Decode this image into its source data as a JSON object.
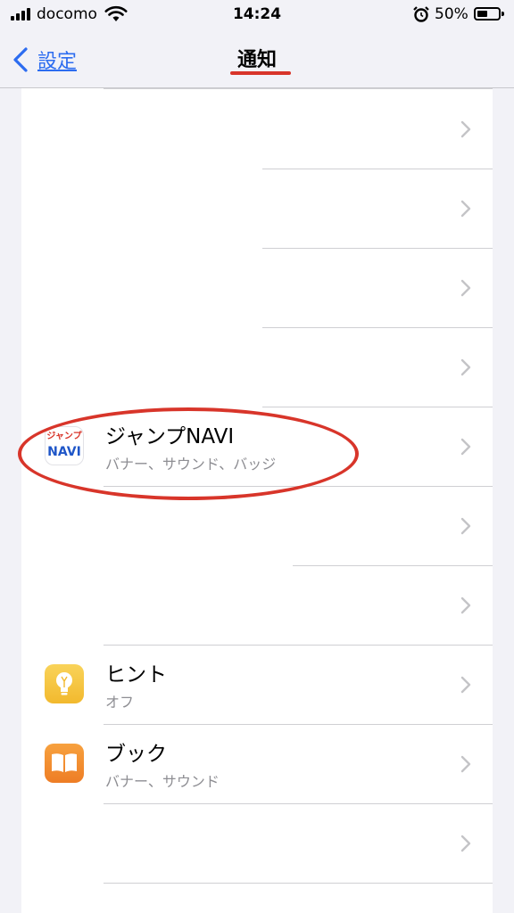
{
  "status_bar": {
    "carrier": "docomo",
    "time": "14:24",
    "battery_percent": "50%",
    "battery_level": 0.5
  },
  "nav": {
    "back_label": "設定",
    "title": "通知"
  },
  "rows": [
    {
      "name": "",
      "subtitle": ""
    },
    {
      "name": "",
      "subtitle": ""
    },
    {
      "name": "",
      "subtitle": ""
    },
    {
      "name": "",
      "subtitle": ""
    },
    {
      "name": "ジャンプNAVI",
      "subtitle": "バナー、サウンド、バッジ",
      "icon": "jump-navi-app-icon",
      "icon_text": [
        "ジャンプ",
        "NAVI"
      ]
    },
    {
      "name": "",
      "subtitle": ""
    },
    {
      "name": "",
      "subtitle": ""
    },
    {
      "name": "ヒント",
      "subtitle": "オフ",
      "icon": "tips-lightbulb-icon"
    },
    {
      "name": "ブック",
      "subtitle": "バナー、サウンド",
      "icon": "books-icon"
    },
    {
      "name": "",
      "subtitle": ""
    }
  ],
  "colors": {
    "accent_blue": "#2c6cf0",
    "annotation_red": "#d8352a",
    "tips_yellow": "#f5c242",
    "books_orange": "#f08a30"
  }
}
